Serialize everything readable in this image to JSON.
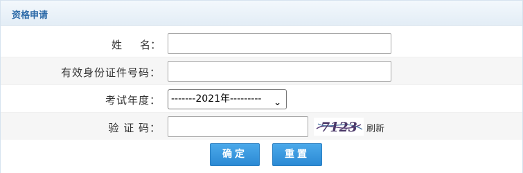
{
  "panel": {
    "title": "资格申请"
  },
  "form": {
    "name_label_first": "姓",
    "name_label_second": "名",
    "colon": "：",
    "id_label": "有效身份证件号码",
    "year_label": "考试年度",
    "year_value": "-------2021年---------",
    "captcha_label": "验 证 码",
    "captcha_text": "7123",
    "refresh_label": "刷新",
    "name_value": "",
    "id_value": "",
    "captcha_value": ""
  },
  "buttons": {
    "confirm_label": "确定",
    "reset_label": "重置"
  },
  "colors": {
    "accent": "#2c8ad4",
    "title": "#2c6aa8",
    "header_bg": "#e3edf6"
  }
}
